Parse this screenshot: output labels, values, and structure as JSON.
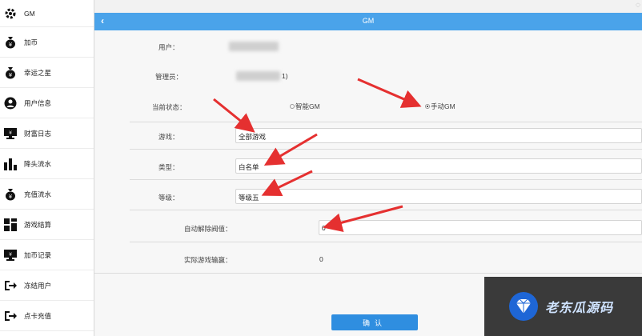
{
  "sidebar": {
    "items": [
      {
        "label": "GM",
        "icon": "gear-icon"
      },
      {
        "label": "加币",
        "icon": "money-bag-icon"
      },
      {
        "label": "幸运之星",
        "icon": "money-bag-icon"
      },
      {
        "label": "用户信息",
        "icon": "user-icon"
      },
      {
        "label": "财富日志",
        "icon": "monitor-icon"
      },
      {
        "label": "降头流水",
        "icon": "bar-chart-icon"
      },
      {
        "label": "充值流水",
        "icon": "money-bag-icon"
      },
      {
        "label": "游戏结算",
        "icon": "grid-icon"
      },
      {
        "label": "加币记录",
        "icon": "monitor-icon"
      },
      {
        "label": "冻结用户",
        "icon": "logout-icon"
      },
      {
        "label": "点卡充值",
        "icon": "logout-icon"
      }
    ]
  },
  "header": {
    "title": "GM",
    "back": "‹"
  },
  "form": {
    "user_label": "用户：",
    "admin_label": "管理员：",
    "admin_suffix": "1)",
    "status_label": "当前状态：",
    "status_options": [
      {
        "label": "智能GM",
        "selected": false
      },
      {
        "label": "手动GM",
        "selected": true
      }
    ],
    "game_label": "游戏：",
    "game_value": "全部游戏",
    "type_label": "类型：",
    "type_value": "白名单",
    "level_label": "等级：",
    "level_value": "等级五",
    "threshold_label": "自动解除阀值：",
    "threshold_value": "0",
    "actual_label": "实际游戏输赢：",
    "actual_value": "0",
    "confirm_label": "确认"
  },
  "watermark": {
    "text": "老东瓜源码"
  },
  "colors": {
    "header": "#4aa3ea",
    "button": "#2f8ee0",
    "arrow": "#e53030"
  }
}
